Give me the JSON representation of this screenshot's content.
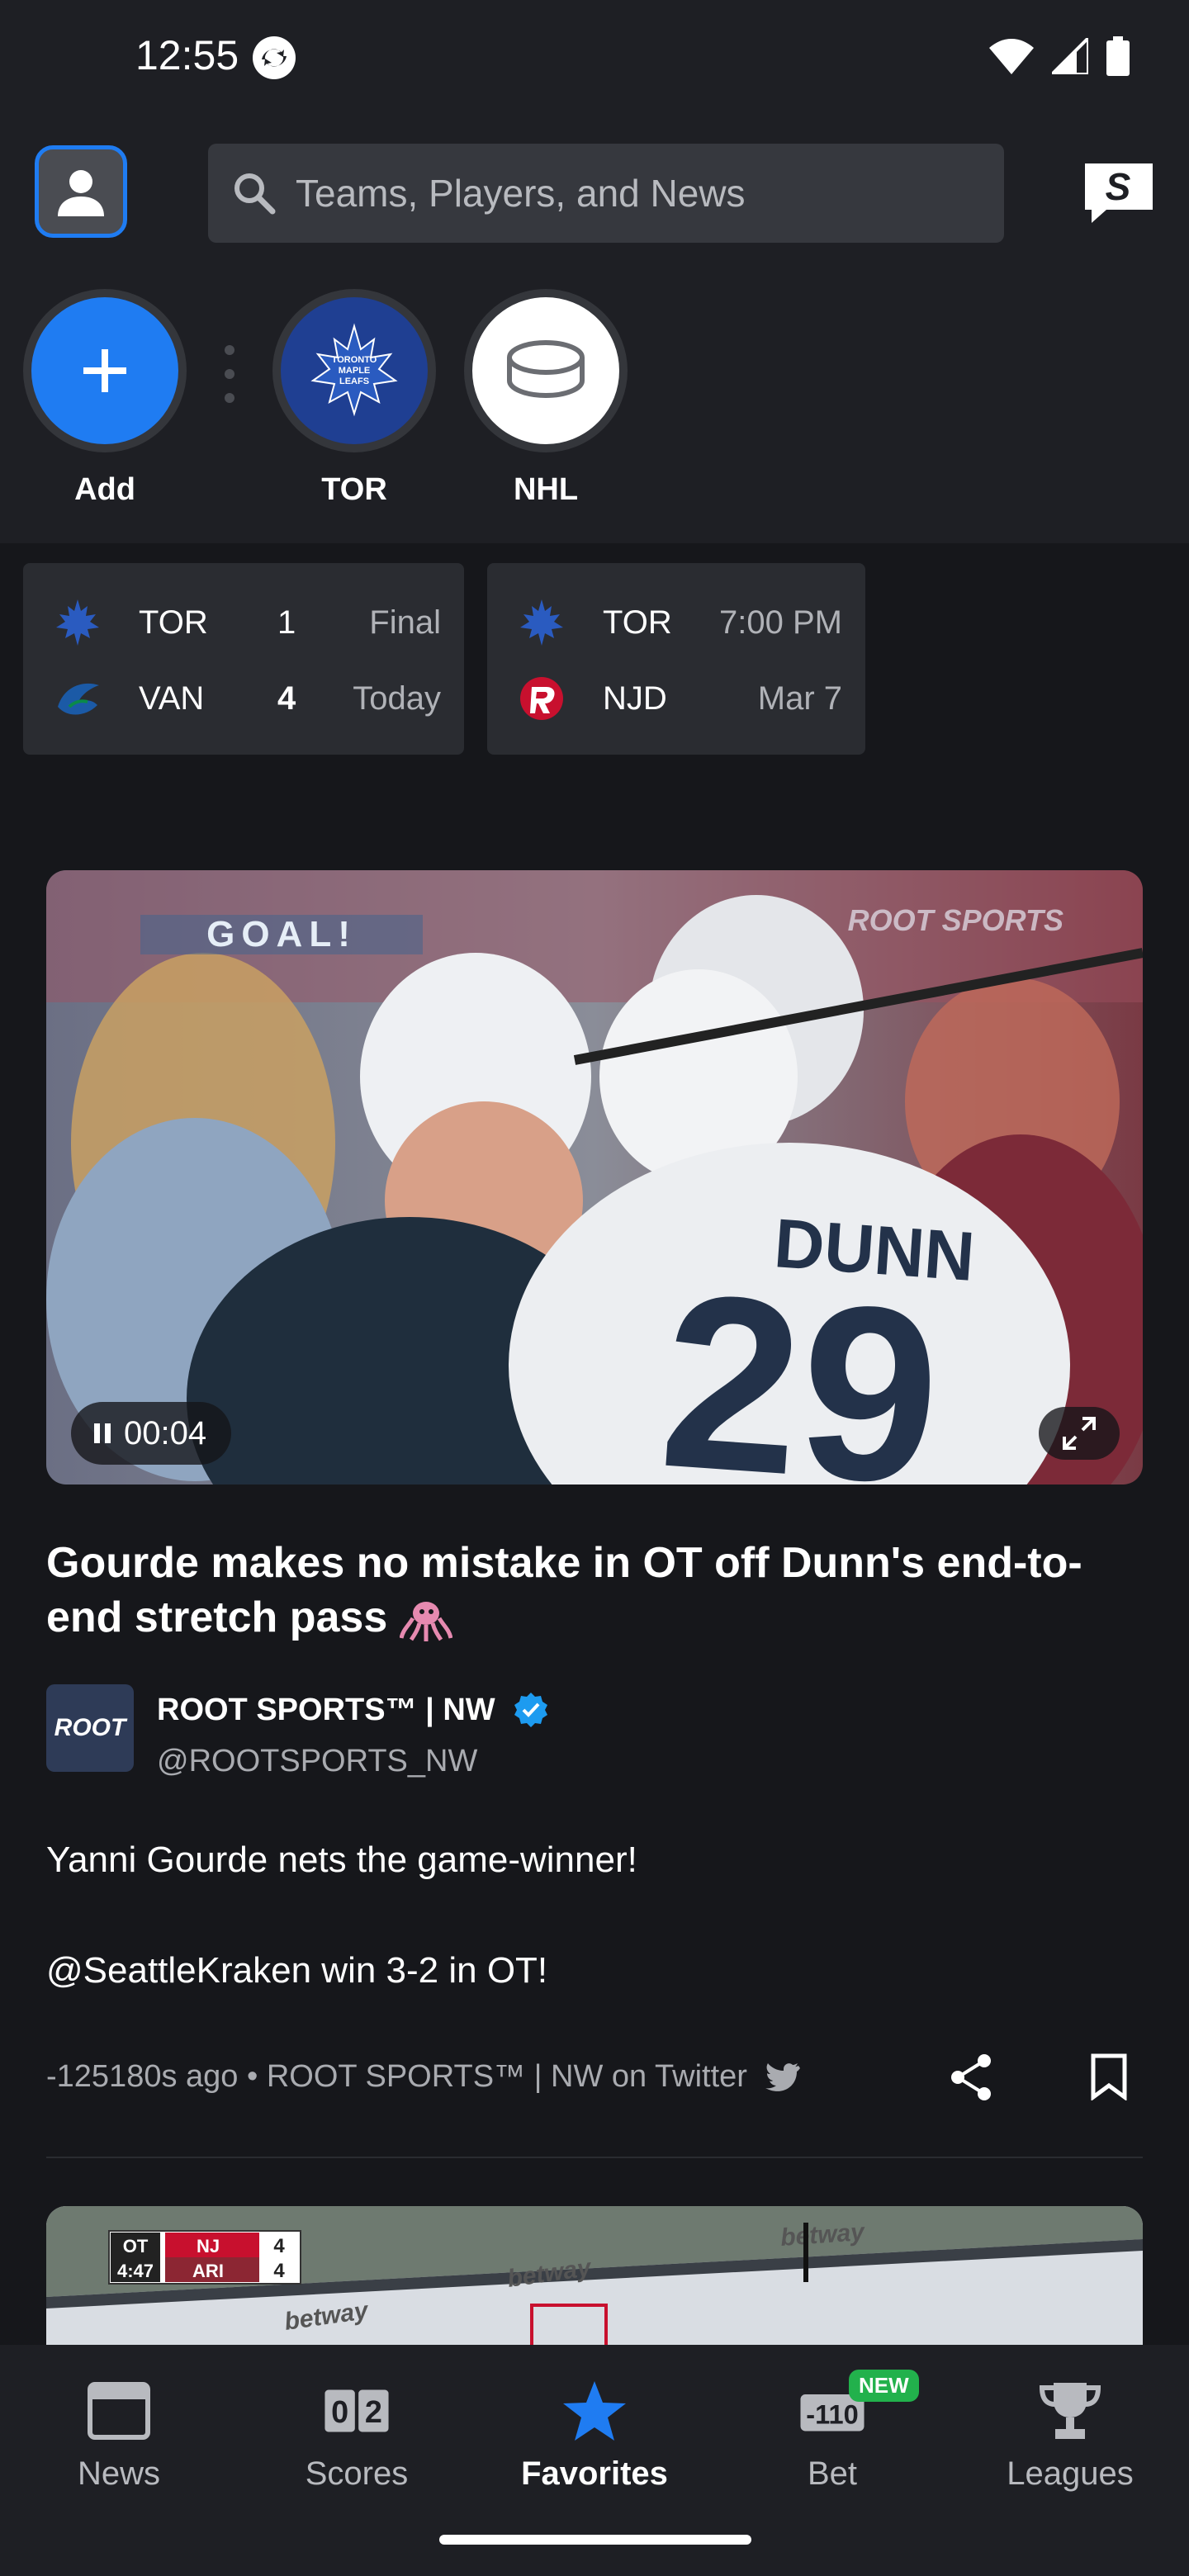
{
  "status_bar": {
    "time": "12:55"
  },
  "search": {
    "placeholder": "Teams, Players, and News"
  },
  "favorites": [
    {
      "label": "Add",
      "icon": "plus-icon"
    },
    {
      "label": "TOR",
      "icon": "maple-leafs-logo"
    },
    {
      "label": "NHL",
      "icon": "hockey-puck-icon"
    }
  ],
  "score_cards": [
    {
      "rows": [
        {
          "team": "TOR",
          "score": "1",
          "status": "Final"
        },
        {
          "team": "VAN",
          "score": "4",
          "status": "Today"
        }
      ]
    },
    {
      "rows": [
        {
          "team": "TOR",
          "score": "",
          "status": "7:00 PM"
        },
        {
          "team": "NJD",
          "score": "",
          "status": "Mar 7"
        }
      ]
    }
  ],
  "video": {
    "elapsed": "00:04",
    "overlay_text": "GOAL!",
    "watermark": "ROOT SPORTS",
    "jersey_name": "DUNN",
    "jersey_number": "29"
  },
  "article": {
    "headline": "Gourde makes no mistake in OT off Dunn's end-to-end stretch pass",
    "author_name": "ROOT SPORTS™ | NW",
    "author_handle": "@ROOTSPORTS_NW",
    "avatar_text": "ROOT",
    "body_lines": [
      "Yanni Gourde nets the game-winner!",
      "@SeattleKraken win 3-2 in OT!"
    ],
    "meta": "-125180s ago • ROOT SPORTS™ | NW on Twitter"
  },
  "next_card": {
    "period": "OT",
    "clock": "4:47",
    "team1": "NJ",
    "score1": "4",
    "team2": "ARI",
    "score2": "4",
    "board_ad": "betway"
  },
  "bottom_nav": {
    "items": [
      {
        "label": "News",
        "icon": "news-icon"
      },
      {
        "label": "Scores",
        "icon": "scores-icon"
      },
      {
        "label": "Favorites",
        "icon": "star-icon"
      },
      {
        "label": "Bet",
        "icon": "bet-icon"
      },
      {
        "label": "Leagues",
        "icon": "trophy-icon"
      }
    ],
    "active": "Favorites",
    "bet_badge": "NEW",
    "bet_odds": "-110",
    "scores_digits": [
      "0",
      "2"
    ]
  },
  "colors": {
    "accent": "#1f7cf2",
    "background": "#16171b",
    "surface": "#2a2c31",
    "badge_green": "#22b14c"
  }
}
